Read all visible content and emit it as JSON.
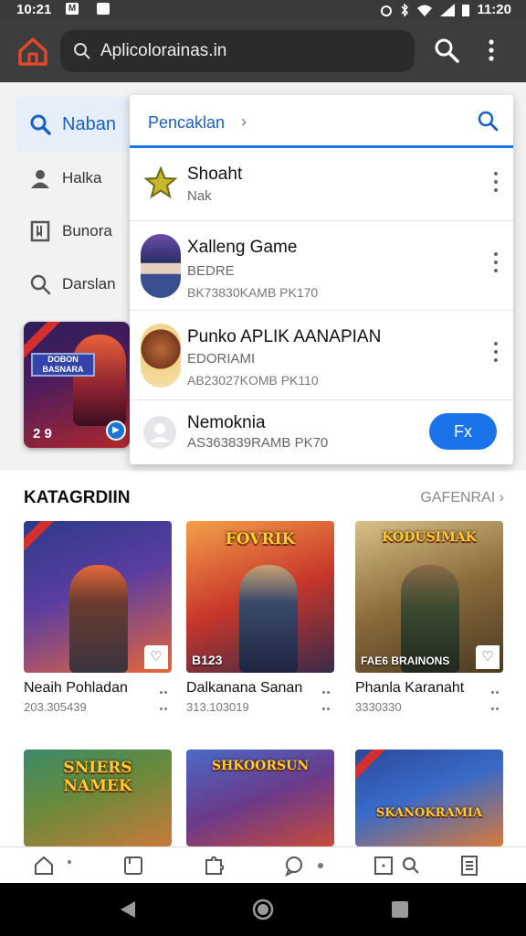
{
  "status_bar": {
    "time": "10:21",
    "notification_letter": "M",
    "clock_right": "11:20"
  },
  "browser": {
    "url": "Aplicolorainas.in"
  },
  "left_nav": {
    "active": {
      "label": "Naban",
      "icon": "search-icon"
    },
    "items": [
      {
        "label": "Halka",
        "icon": "person-icon"
      },
      {
        "label": "Bunora",
        "icon": "bookmark-icon"
      },
      {
        "label": "Darslan",
        "icon": "search-icon"
      }
    ],
    "promo": {
      "number": "2 9",
      "title": "DOBON BASNARA"
    }
  },
  "panel": {
    "title": "Pencaklan",
    "results": [
      {
        "name": "Shoaht",
        "sub": "Nak",
        "icon": "star-icon"
      },
      {
        "name": "Xalleng Game",
        "sub": "BEDRE",
        "meta": "BK73830KAMB PK170",
        "icon": "avatar-agent"
      },
      {
        "name": "Punko APLIK AANAPIAN",
        "sub": "EDORIAMI",
        "meta": "AB23027KOMB PK110",
        "icon": "avatar-hero"
      },
      {
        "name": "Nemoknia",
        "sub": "AS363839RAMB PK70",
        "icon": "user-placeholder-icon",
        "button": "Fx"
      }
    ]
  },
  "categories": {
    "title": "KATAGRDIIN",
    "more": "GAFENRAI",
    "cards": [
      {
        "name": "Neaih Pohladan",
        "count": "203.305439",
        "badge": "",
        "logo": ""
      },
      {
        "name": "Dalkanana Sanan",
        "count": "313.103019",
        "badge": "B123",
        "logo": "FOVRIK"
      },
      {
        "name": "Phanla Karanaht",
        "count": "3330330",
        "badge": "FAE6 BRAINONS",
        "logo": "KODUSIMAK"
      },
      {
        "name": "",
        "count": "",
        "badge": "",
        "logo": "SNIERS NAMEK"
      },
      {
        "name": "",
        "count": "",
        "badge": "",
        "logo": "SHKOORSUN"
      },
      {
        "name": "",
        "count": "",
        "badge": "",
        "logo": "SKANOKRAMIA"
      }
    ]
  },
  "colors": {
    "accent": "#1a73e8",
    "toolbar": "#3d3d3d",
    "home_icon": "#e04a2a"
  }
}
